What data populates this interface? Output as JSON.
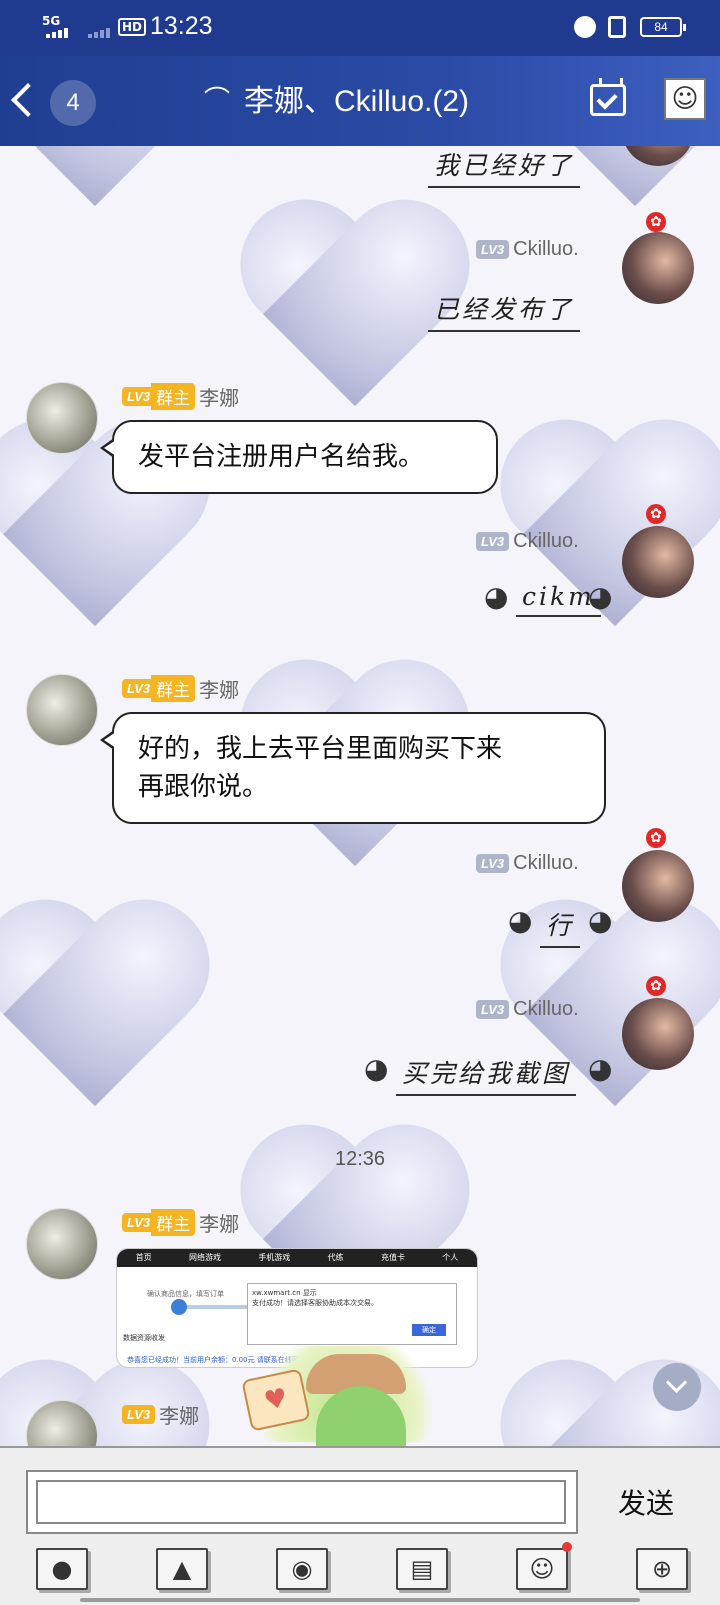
{
  "status_bar": {
    "network": "5G",
    "hd_label": "HD",
    "time": "13:23",
    "battery": "84"
  },
  "header": {
    "unread_count": "4",
    "title": "李娜、Ckilluo.(2)"
  },
  "messages": [
    {
      "sender": "Ckilluo.",
      "level": "LV3",
      "text": "我已经好了"
    },
    {
      "sender": "Ckilluo.",
      "level": "LV3",
      "text": "已经发布了"
    },
    {
      "sender": "李娜",
      "level": "LV3",
      "role": "群主",
      "text": "发平台注册用户名给我。"
    },
    {
      "sender": "Ckilluo.",
      "level": "LV3",
      "text": "cikm"
    },
    {
      "sender": "李娜",
      "level": "LV3",
      "role": "群主",
      "text_line1": "好的，我上去平台里面购买下来",
      "text_line2": "再跟你说。"
    },
    {
      "sender": "Ckilluo.",
      "level": "LV3",
      "text": "行"
    },
    {
      "sender": "Ckilluo.",
      "level": "LV3",
      "text": "买完给我截图"
    },
    {
      "sender": "李娜",
      "level": "LV3",
      "role": "群主",
      "image": true
    },
    {
      "sender": "李娜",
      "level": "LV3",
      "partial": true
    }
  ],
  "timestamp": "12:36",
  "screenshot_image": {
    "tabs": [
      "首页",
      "网络游戏",
      "手机游戏",
      "代练",
      "充值卡",
      "个人"
    ],
    "progress_label": "确认商品信息，填写订单",
    "dialog_title": "xw.xwmart.cn 显示",
    "dialog_text": "支付成功！请选择客服协助成本次交易。",
    "dialog_ok": "确定",
    "section": "数据资源收发",
    "footer": "恭喜您已经成功！当前用户余额：0.00元   请联系在线客服帮您完成本次交易。"
  },
  "input": {
    "placeholder": "",
    "send_label": "发送"
  },
  "toolbar": {
    "icons": [
      "microphone-icon",
      "image-icon",
      "camera-icon",
      "file-icon",
      "emoji-icon",
      "plus-icon"
    ]
  }
}
